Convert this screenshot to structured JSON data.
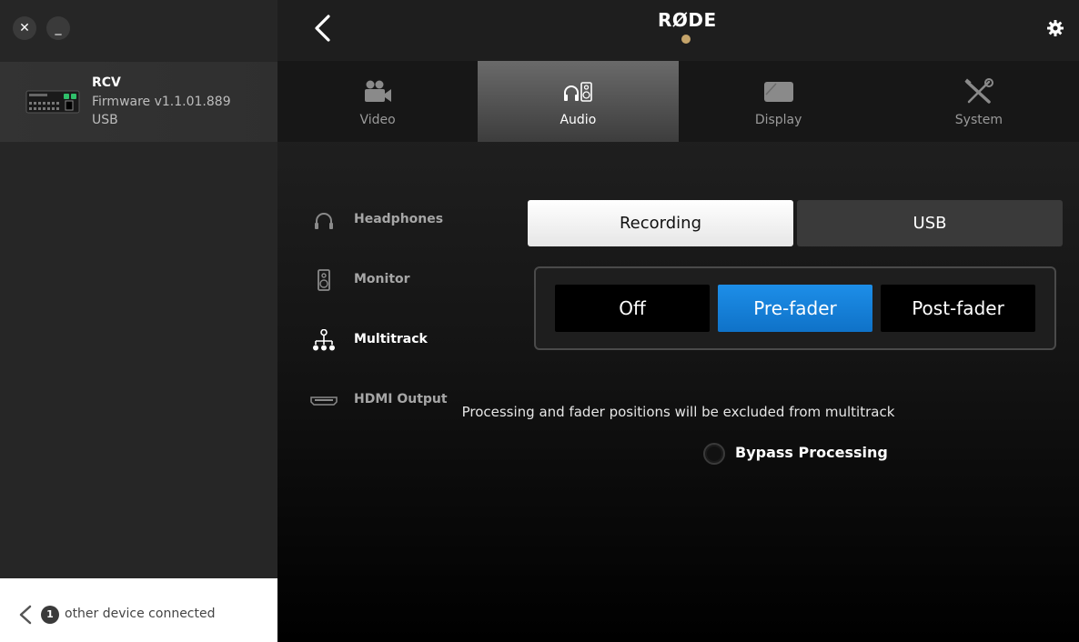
{
  "window": {
    "close_glyph": "✕",
    "minimize_glyph": "_"
  },
  "device": {
    "name": "RCV",
    "firmware": "Firmware v1.1.01.889",
    "connection": "USB",
    "image_icon": "device-thumbnail"
  },
  "other_devices": {
    "count": "1",
    "label": "other device connected"
  },
  "header": {
    "brand": "RØDE",
    "accent": "#c5a46a"
  },
  "tabs": [
    {
      "label": "Video",
      "icon": "camera-icon"
    },
    {
      "label": "Audio",
      "icon": "headphones-speaker-icon"
    },
    {
      "label": "Display",
      "icon": "display-icon"
    },
    {
      "label": "System",
      "icon": "tools-icon"
    }
  ],
  "active_tab": "Audio",
  "subnav": [
    {
      "label": "Headphones",
      "icon": "headphones-icon"
    },
    {
      "label": "Monitor",
      "icon": "speaker-icon"
    },
    {
      "label": "Multitrack",
      "icon": "multitrack-icon"
    },
    {
      "label": "HDMI Output",
      "icon": "hdmi-icon"
    }
  ],
  "active_subnav": "Multitrack",
  "target_tabs": {
    "recording": "Recording",
    "usb": "USB",
    "selected": "Recording"
  },
  "modes": {
    "off": "Off",
    "pre": "Pre-fader",
    "post": "Post-fader",
    "selected": "Pre-fader",
    "selected_color": "#1a86dd"
  },
  "info": "Processing and fader positions will be excluded from multitrack",
  "bypass": {
    "label": "Bypass Processing",
    "checked": false
  }
}
